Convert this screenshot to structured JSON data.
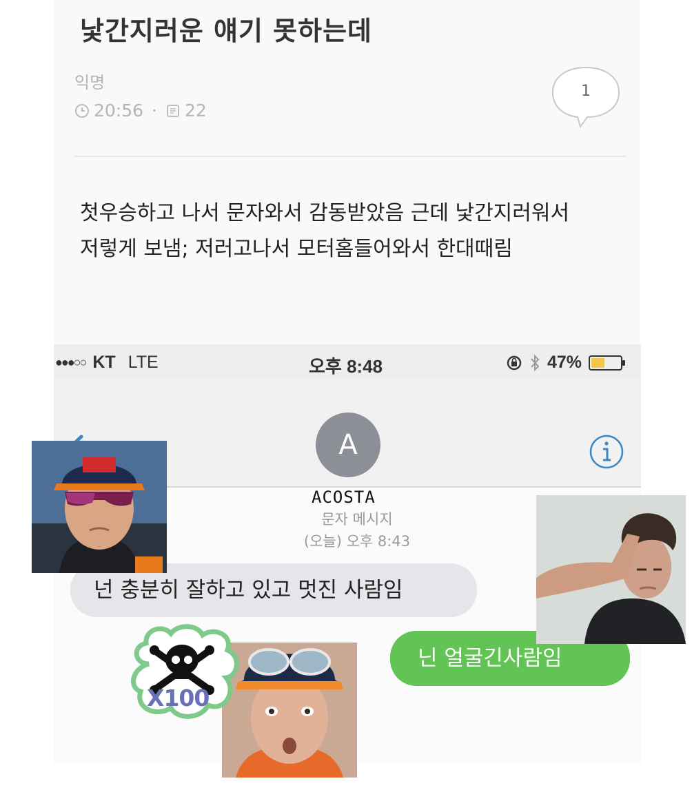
{
  "post": {
    "title": "낯간지러운 얘기 못하는데",
    "author": "익명",
    "time": "20:56",
    "separator": "·",
    "views": "22",
    "comment_count": "1",
    "body_line1": "첫우승하고 나서 문자와서 감동받았음 근데 낯간지러워서",
    "body_line2": "저렇게 보냄; 저러고나서 모터홈들어와서 한대때림"
  },
  "status_bar": {
    "signal": "●●●○○",
    "carrier": "KT",
    "network": "LTE",
    "time": "오후 8:48",
    "battery_percent": "47%",
    "battery_level": 0.47
  },
  "conversation": {
    "avatar_initial": "A",
    "contact_name": "ACOSTA",
    "message_type": "문자 메시지",
    "message_time": "(오늘) 오후 8:43",
    "incoming_message": "넌 충분히 잘하고 있고 멋진 사람임",
    "outgoing_message": "닌 얼굴긴사람임"
  },
  "sticker": {
    "label": "X100",
    "icon": "skull-crossbones-icon"
  },
  "colors": {
    "ios_blue": "#3a87c8",
    "incoming_bubble": "#e5e5ea",
    "outgoing_bubble": "#62c454",
    "avatar_gray": "#8c8f96",
    "sticker_green": "#7fc98a"
  }
}
